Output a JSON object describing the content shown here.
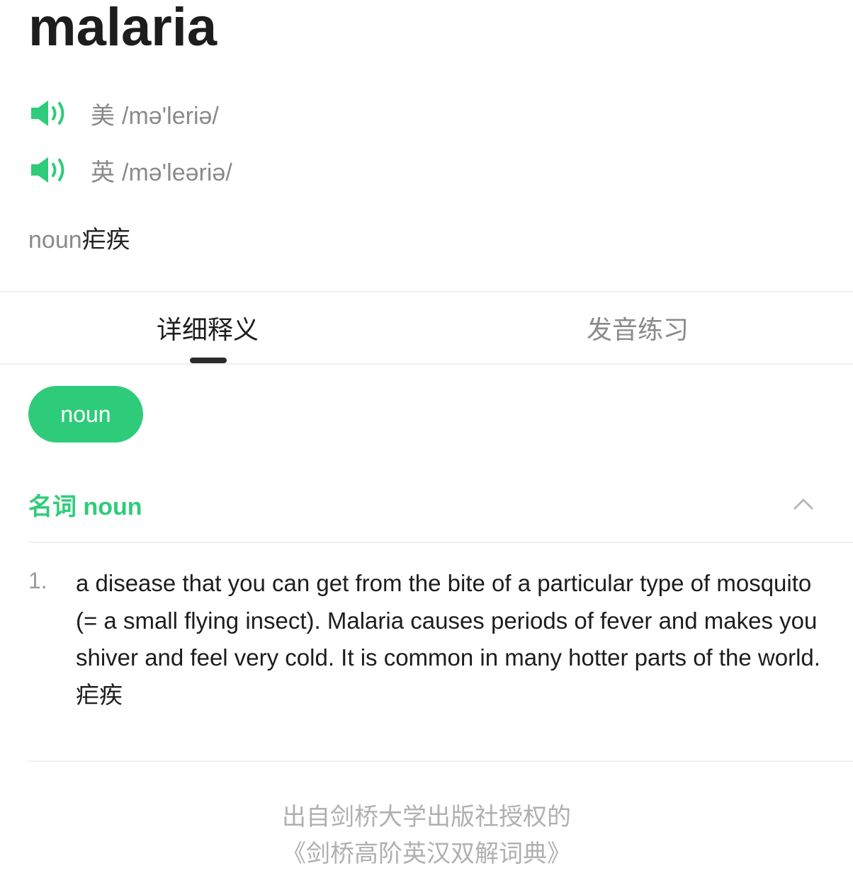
{
  "word": "malaria",
  "pronunciations": [
    {
      "region": "美",
      "ipa": "/mə'leriə/",
      "icon": "speaker-icon"
    },
    {
      "region": "英",
      "ipa": "/mə'leəriə/",
      "icon": "speaker-icon"
    }
  ],
  "brief": {
    "pos": "noun",
    "meaning": "疟疾"
  },
  "tabs": [
    {
      "label": "详细释义",
      "active": true
    },
    {
      "label": "发音练习",
      "active": false
    }
  ],
  "pos_chip": "noun",
  "section": {
    "title": "名词 noun",
    "toggle_icon": "chevron-up-icon"
  },
  "definitions": [
    {
      "number": "1.",
      "text": "a disease that you can get from the bite of a particular type of mosquito (= a small flying insect). Malaria causes periods of fever and makes you shiver and feel very cold. It is common in many hotter parts of the world. 疟疾"
    }
  ],
  "source": {
    "line1": "出自剑桥大学出版社授权的",
    "line2": "《剑桥高阶英汉双解词典》"
  },
  "colors": {
    "accent": "#2ecc7a",
    "muted": "#8a8a8a",
    "text": "#1d1d1d"
  }
}
